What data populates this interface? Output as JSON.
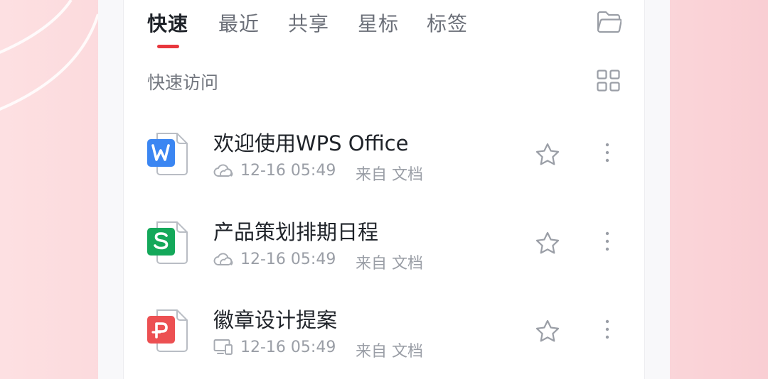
{
  "tabs": [
    {
      "label": "快速",
      "active": true
    },
    {
      "label": "最近",
      "active": false
    },
    {
      "label": "共享",
      "active": false
    },
    {
      "label": "星标",
      "active": false
    },
    {
      "label": "标签",
      "active": false
    }
  ],
  "section": {
    "title": "快速访问"
  },
  "files": [
    {
      "name": "欢迎使用WPS Office",
      "type": "writer",
      "type_letter": "W",
      "time": "12-16 05:49",
      "source": "来自 文档",
      "location": "cloud",
      "color": "#3b86f2"
    },
    {
      "name": "产品策划排期日程",
      "type": "sheet",
      "type_letter": "S",
      "time": "12-16 05:49",
      "source": "来自 文档",
      "location": "cloud",
      "color": "#14a85a"
    },
    {
      "name": "徽章设计提案",
      "type": "presentation",
      "type_letter": "P",
      "time": "12-16 05:49",
      "source": "来自 文档",
      "location": "device",
      "color": "#ec5052"
    }
  ],
  "icons": {
    "folder": "folder-icon",
    "grid": "grid-view-icon",
    "cloud": "cloud-icon",
    "device": "device-icon",
    "star": "star-icon",
    "more": "more-vertical-icon"
  },
  "colors": {
    "accent": "#e8373d",
    "text_primary": "#1f2329",
    "text_secondary": "#9a9ea6"
  }
}
